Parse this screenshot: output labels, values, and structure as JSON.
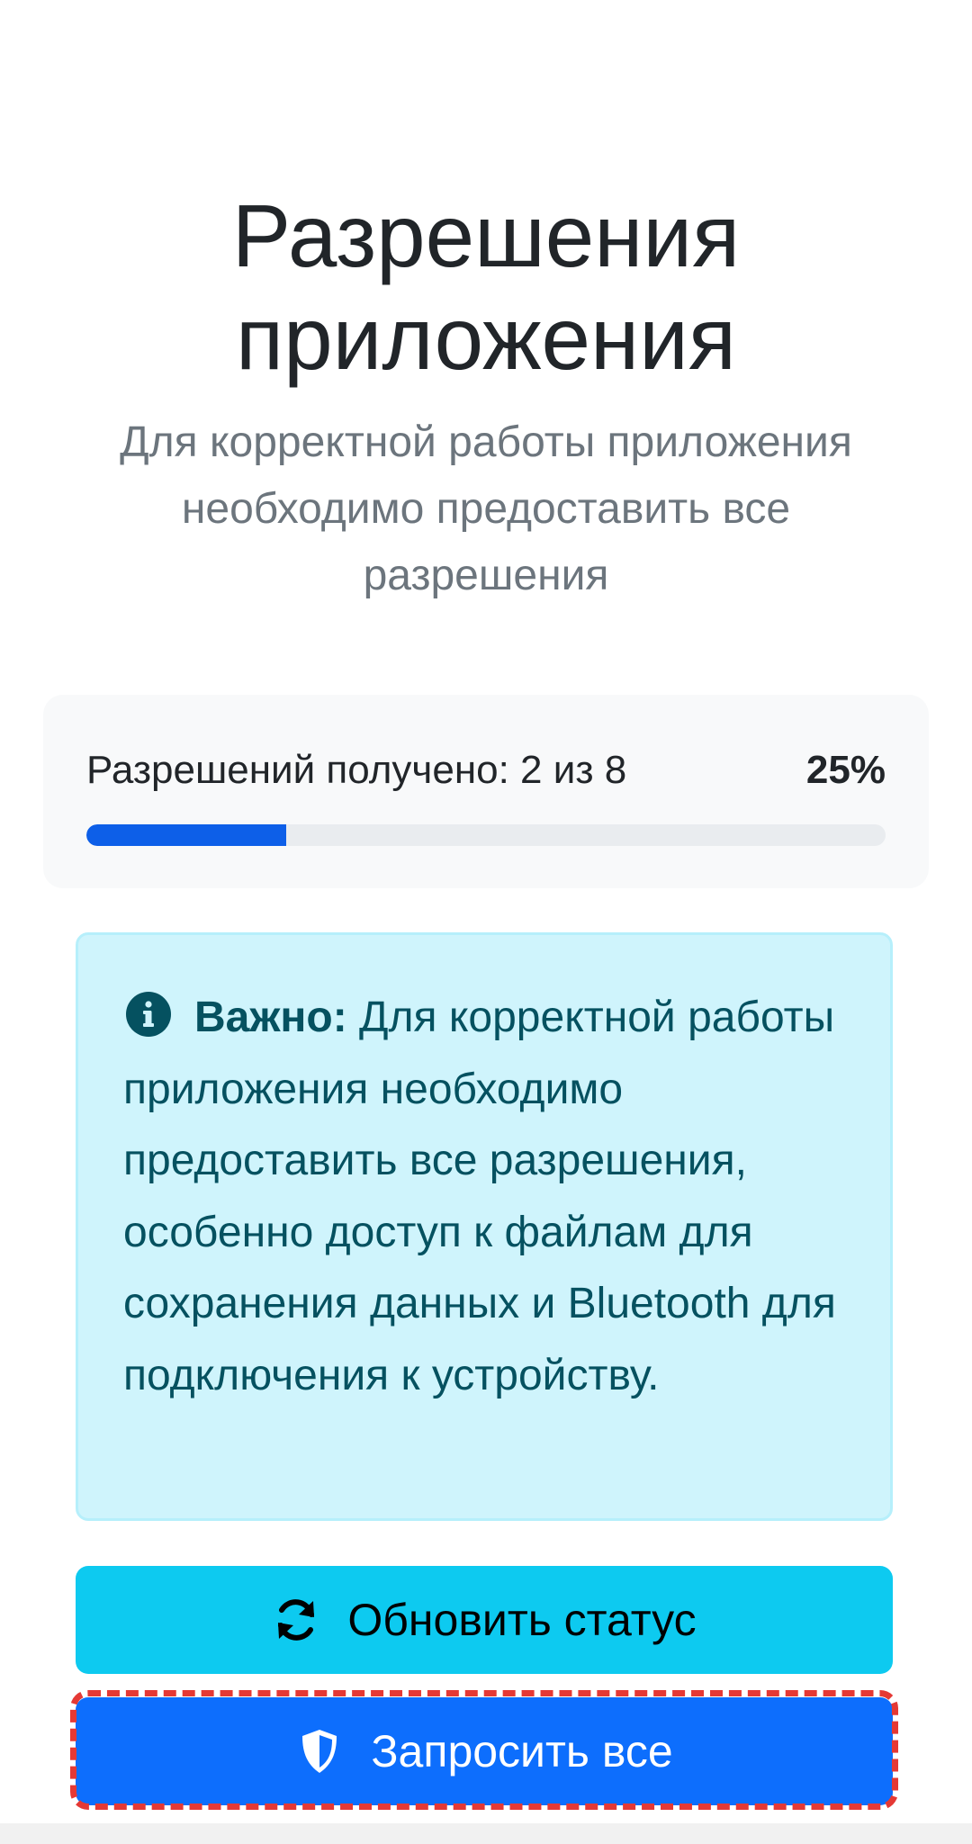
{
  "header": {
    "title": "Разрешения приложения",
    "subtitle": "Для корректной работы приложения необходимо предоставить все разрешения"
  },
  "progress": {
    "label": "Разрешений получено: 2 из 8",
    "percent_text": "25%",
    "granted": 2,
    "total": 8,
    "fraction": 0.25,
    "fill_color": "#0d5fe8"
  },
  "alert": {
    "icon": "info-circle-icon",
    "strong": "Важно:",
    "text": " Для корректной работы приложения необходимо предоставить все разрешения, особенно доступ к файлам для сохранения данных и Bluetooth для подключения к устройству.",
    "background": "#cff4fc",
    "text_color": "#055160"
  },
  "actions": {
    "refresh": {
      "label": "Обновить статус",
      "icon": "refresh-icon",
      "color": "#0dcaf0"
    },
    "request_all": {
      "label": "Запросить все",
      "icon": "shield-icon",
      "color": "#0d6efd"
    }
  }
}
